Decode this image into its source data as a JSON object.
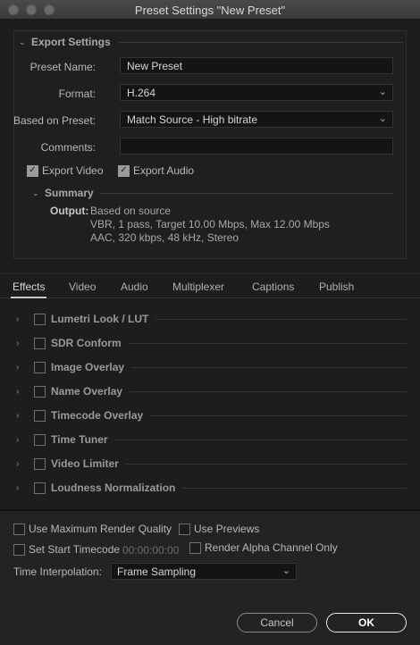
{
  "window": {
    "title": "Preset Settings \"New Preset\""
  },
  "export_settings": {
    "section_title": "Export Settings",
    "preset_name_label": "Preset Name:",
    "preset_name_value": "New Preset",
    "format_label": "Format:",
    "format_value": "H.264",
    "based_on_label": "Based on Preset:",
    "based_on_value": "Match Source - High bitrate",
    "comments_label": "Comments:",
    "comments_value": "",
    "export_video_label": "Export Video",
    "export_video_checked": true,
    "export_audio_label": "Export Audio",
    "export_audio_checked": true,
    "summary_title": "Summary",
    "output_label": "Output:",
    "output_lines": [
      "Based on source",
      "VBR, 1 pass, Target 10.00 Mbps, Max 12.00 Mbps",
      "AAC, 320 kbps, 48 kHz, Stereo"
    ]
  },
  "tabs": [
    {
      "label": "Effects",
      "active": true
    },
    {
      "label": "Video",
      "active": false
    },
    {
      "label": "Audio",
      "active": false
    },
    {
      "label": "Multiplexer",
      "active": false
    },
    {
      "label": "Captions",
      "active": false
    },
    {
      "label": "Publish",
      "active": false
    }
  ],
  "effects": [
    {
      "label": "Lumetri Look / LUT",
      "checked": false
    },
    {
      "label": "SDR Conform",
      "checked": false
    },
    {
      "label": "Image Overlay",
      "checked": false
    },
    {
      "label": "Name Overlay",
      "checked": false
    },
    {
      "label": "Timecode Overlay",
      "checked": false
    },
    {
      "label": "Time Tuner",
      "checked": false
    },
    {
      "label": "Video Limiter",
      "checked": false
    },
    {
      "label": "Loudness Normalization",
      "checked": false
    }
  ],
  "bottom": {
    "max_render_quality_label": "Use Maximum Render Quality",
    "use_previews_label": "Use Previews",
    "set_start_timecode_label": "Set Start Timecode",
    "start_timecode_value": "00:00:00:00",
    "render_alpha_label": "Render Alpha Channel Only",
    "time_interpolation_label": "Time Interpolation:",
    "time_interpolation_value": "Frame Sampling"
  },
  "buttons": {
    "cancel": "Cancel",
    "ok": "OK"
  }
}
